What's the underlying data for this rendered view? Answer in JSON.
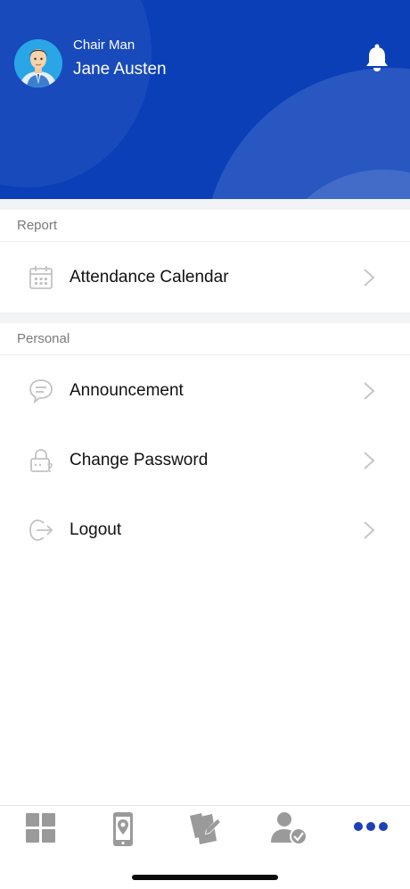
{
  "header": {
    "role": "Chair Man",
    "user_name": "Jane Austen",
    "accent_color": "#0a3fb8"
  },
  "sections": [
    {
      "title": "Report",
      "items": [
        {
          "label": "Attendance Calendar",
          "icon": "calendar-icon"
        }
      ]
    },
    {
      "title": "Personal",
      "items": [
        {
          "label": "Announcement",
          "icon": "chat-bubble-icon"
        },
        {
          "label": "Change Password",
          "icon": "lock-icon"
        },
        {
          "label": "Logout",
          "icon": "logout-icon"
        }
      ]
    }
  ],
  "tabbar": {
    "tabs": [
      {
        "icon": "dashboard-grid-icon",
        "active": false
      },
      {
        "icon": "phone-location-icon",
        "active": false
      },
      {
        "icon": "document-edit-icon",
        "active": false
      },
      {
        "icon": "user-check-icon",
        "active": false
      },
      {
        "icon": "more-dots-icon",
        "active": true
      }
    ],
    "active_color": "#1e3fb4",
    "inactive_color": "#9a9a9a"
  }
}
